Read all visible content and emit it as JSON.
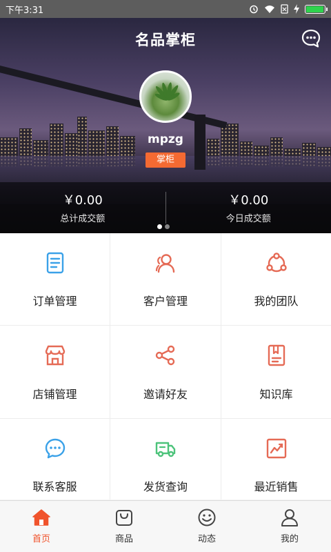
{
  "status_bar": {
    "time": "下午3:31"
  },
  "header": {
    "title": "名品掌柜"
  },
  "profile": {
    "username": "mpzg",
    "role": "掌柜"
  },
  "stats": [
    {
      "amount": "￥0.00",
      "label": "总计成交额"
    },
    {
      "amount": "￥0.00",
      "label": "今日成交额"
    }
  ],
  "carousel": {
    "total_pages": 2,
    "active_page": 1
  },
  "menu": [
    {
      "label": "订单管理",
      "icon": "order-icon"
    },
    {
      "label": "客户管理",
      "icon": "customer-icon"
    },
    {
      "label": "我的团队",
      "icon": "team-icon"
    },
    {
      "label": "店铺管理",
      "icon": "store-icon"
    },
    {
      "label": "邀请好友",
      "icon": "share-icon"
    },
    {
      "label": "知识库",
      "icon": "book-icon"
    },
    {
      "label": "联系客服",
      "icon": "service-icon"
    },
    {
      "label": "发货查询",
      "icon": "truck-icon"
    },
    {
      "label": "最近销售",
      "icon": "chart-icon"
    }
  ],
  "bottom_nav": [
    {
      "label": "首页",
      "icon": "home-icon",
      "active": true
    },
    {
      "label": "商品",
      "icon": "bag-icon",
      "active": false
    },
    {
      "label": "动态",
      "icon": "smile-icon",
      "active": false
    },
    {
      "label": "我的",
      "icon": "user-icon",
      "active": false
    }
  ],
  "colors": {
    "accent": "#f0532c",
    "badge": "#f46a32",
    "icon_blue": "#3aa1e8",
    "icon_red": "#e56a55",
    "icon_green": "#4cc37a",
    "battery": "#2ed34d"
  }
}
